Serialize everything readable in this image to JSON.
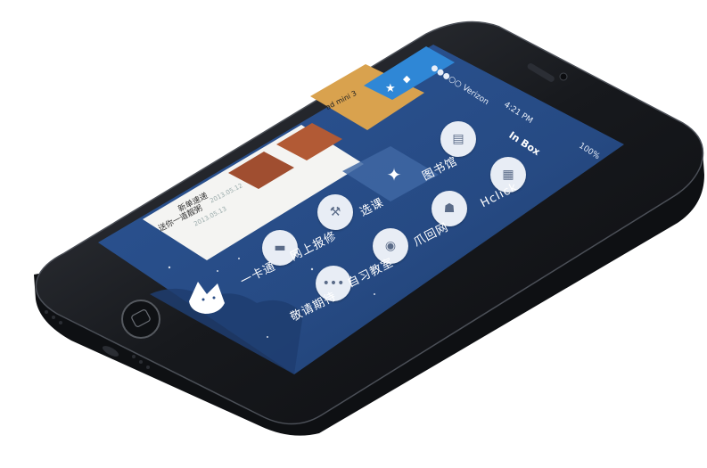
{
  "status_bar": {
    "carrier": "●●●○○ Verizon",
    "time": "4:21 PM",
    "battery": "100%"
  },
  "app": {
    "title": "In Box"
  },
  "menu": {
    "library": "图书馆",
    "course": "选课",
    "hclick": "Hclick",
    "repair": "网上报修",
    "zhuahui": "爪回网",
    "card": "一卡通",
    "study_room": "自习教室",
    "coming_soon": "敬请期待"
  },
  "cards": [
    {
      "title": "新单速递",
      "date": "2013.05.12"
    },
    {
      "title": "送你一道靓粥",
      "date": "2013.05.13"
    }
  ],
  "banner": {
    "line1": "ad mini 3"
  },
  "colors": {
    "screen_bg": "#2b4d86",
    "panel_blue": "#2f87d6",
    "phone_body": "#1b1d22",
    "icon_bg": "#e8edf5"
  },
  "icons": {
    "star": "star-icon",
    "cube": "cube-icon",
    "book": "book-icon",
    "wand": "wand-icon",
    "board": "board-icon",
    "wrench": "wrench-icon",
    "cat": "cat-icon",
    "bus": "card-icon",
    "bell": "bell-icon",
    "dots": "dots-icon"
  }
}
